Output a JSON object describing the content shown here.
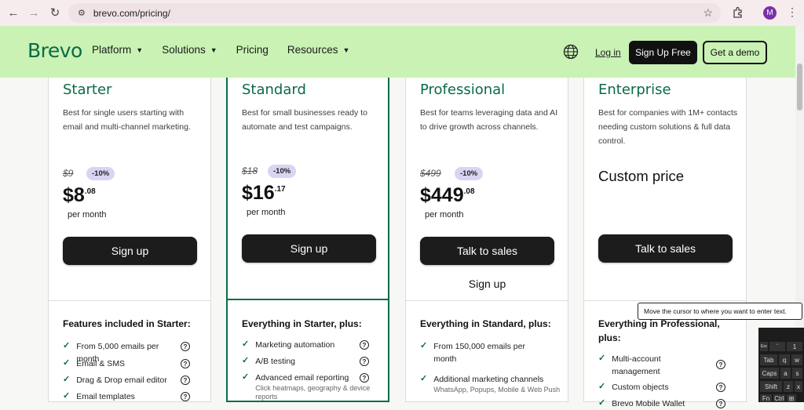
{
  "browser": {
    "url": "brevo.com/pricing/",
    "avatar_letter": "M"
  },
  "nav": {
    "logo": "Brevo",
    "menu": [
      {
        "label": "Platform",
        "dropdown": true
      },
      {
        "label": "Solutions",
        "dropdown": true
      },
      {
        "label": "Pricing",
        "dropdown": false
      },
      {
        "label": "Resources",
        "dropdown": true
      }
    ],
    "login": "Log in",
    "signup": "Sign Up Free",
    "demo": "Get a demo"
  },
  "plans": [
    {
      "name": "Starter",
      "desc": "Best for single users starting with email and multi-channel marketing.",
      "old_price": "$9",
      "discount": "-10%",
      "price_main": "$8",
      "price_cents": ".08",
      "per": "per month",
      "cta": "Sign up",
      "features_title": "Features included in Starter:",
      "features": [
        {
          "text": "From 5,000 emails per month",
          "sub": "",
          "help": true
        },
        {
          "text": "Email & SMS",
          "sub": "",
          "help": true
        },
        {
          "text": "Drag & Drop email editor",
          "sub": "",
          "help": true
        },
        {
          "text": "Email templates",
          "sub": "",
          "help": true
        }
      ]
    },
    {
      "name": "Standard",
      "desc": "Best for small businesses ready to automate and test campaigns.",
      "old_price": "$18",
      "discount": "-10%",
      "price_main": "$16",
      "price_cents": ".17",
      "per": "per month",
      "cta": "Sign up",
      "features_title": "Everything in Starter, plus:",
      "features": [
        {
          "text": "Marketing automation",
          "sub": "",
          "help": true
        },
        {
          "text": "A/B testing",
          "sub": "",
          "help": true
        },
        {
          "text": "Advanced email reporting",
          "sub": "Click heatmaps, geography & device reports",
          "help": true
        }
      ]
    },
    {
      "name": "Professional",
      "desc": "Best for teams leveraging data and AI to drive growth across channels.",
      "old_price": "$499",
      "discount": "-10%",
      "price_main": "$449",
      "price_cents": ".08",
      "per": "per month",
      "cta": "Talk to sales",
      "cta_secondary": "Sign up",
      "features_title": "Everything in Standard, plus:",
      "features": [
        {
          "text": "From 150,000 emails per month",
          "sub": "",
          "help": false
        },
        {
          "text": "Additional marketing channels",
          "sub": "WhatsApp, Popups, Mobile & Web Push",
          "help": false
        }
      ]
    },
    {
      "name": "Enterprise",
      "desc": "Best for companies with 1M+ contacts needing custom solutions & full data control.",
      "custom_price": "Custom price",
      "cta": "Talk to sales",
      "features_title": "Everything in Professional, plus:",
      "features": [
        {
          "text": "Multi-account management",
          "sub": "",
          "help": true
        },
        {
          "text": "Custom objects",
          "sub": "",
          "help": true
        },
        {
          "text": "Brevo Mobile Wallet",
          "sub": "",
          "help": true
        }
      ]
    }
  ],
  "tooltip": "Move the cursor to where you want to enter text.",
  "keyboard": {
    "keys": [
      "Esc",
      "`",
      "1",
      "Tab",
      "q",
      "w",
      "Caps",
      "a",
      "s",
      "Shift",
      "z",
      "x",
      "Fn",
      "Ctrl",
      "⊞"
    ]
  },
  "colors": {
    "brand_green": "#0b6b45",
    "nav_bg": "#c9f2b4",
    "discount_bg": "#d9d4f2"
  }
}
